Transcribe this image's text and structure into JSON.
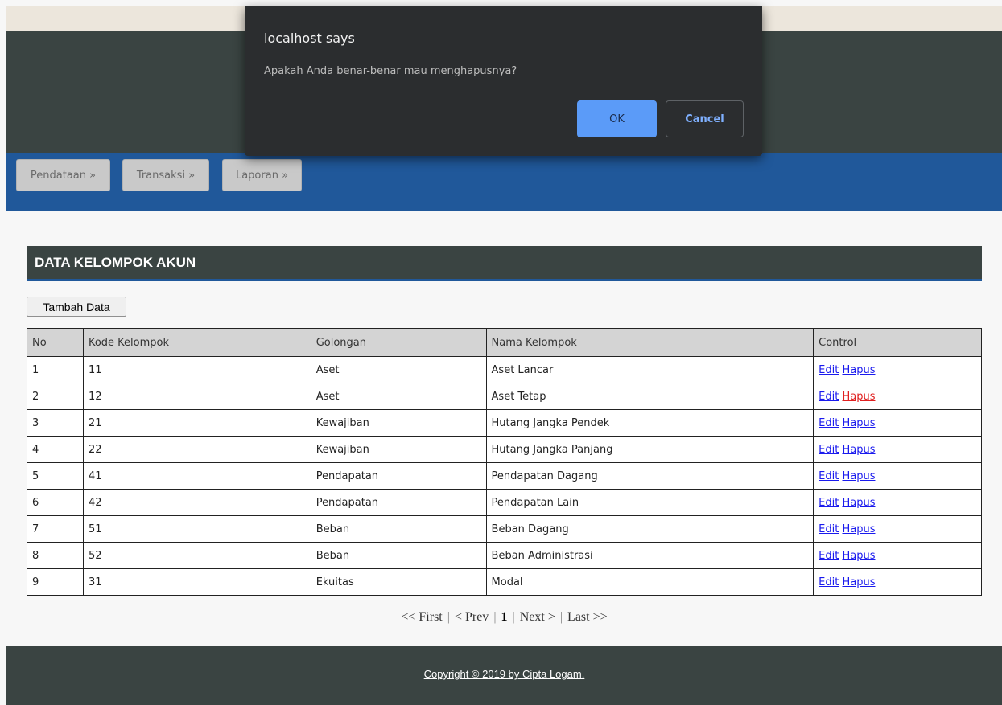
{
  "dialog": {
    "title": "localhost says",
    "message": "Apakah Anda benar-benar mau menghapusnya?",
    "ok_label": "OK",
    "cancel_label": "Cancel"
  },
  "nav": {
    "items": [
      {
        "label": "Pendataan »"
      },
      {
        "label": "Transaksi »"
      },
      {
        "label": "Laporan »"
      }
    ]
  },
  "section": {
    "title": "DATA KELOMPOK AKUN",
    "add_button": "Tambah Data"
  },
  "table": {
    "headers": [
      "No",
      "Kode Kelompok",
      "Golongan",
      "Nama Kelompok",
      "Control"
    ],
    "edit_label": "Edit",
    "hapus_label": "Hapus",
    "rows": [
      {
        "no": "1",
        "kode": "11",
        "golongan": "Aset",
        "nama": "Aset Lancar"
      },
      {
        "no": "2",
        "kode": "12",
        "golongan": "Aset",
        "nama": "Aset Tetap"
      },
      {
        "no": "3",
        "kode": "21",
        "golongan": "Kewajiban",
        "nama": "Hutang Jangka Pendek"
      },
      {
        "no": "4",
        "kode": "22",
        "golongan": "Kewajiban",
        "nama": "Hutang Jangka Panjang"
      },
      {
        "no": "5",
        "kode": "41",
        "golongan": "Pendapatan",
        "nama": "Pendapatan Dagang"
      },
      {
        "no": "6",
        "kode": "42",
        "golongan": "Pendapatan",
        "nama": "Pendapatan Lain"
      },
      {
        "no": "7",
        "kode": "51",
        "golongan": "Beban",
        "nama": "Beban Dagang"
      },
      {
        "no": "8",
        "kode": "52",
        "golongan": "Beban",
        "nama": "Beban Administrasi"
      },
      {
        "no": "9",
        "kode": "31",
        "golongan": "Ekuitas",
        "nama": "Modal"
      }
    ]
  },
  "pager": {
    "first": "<< First",
    "prev": "< Prev",
    "current": "1",
    "next": "Next >",
    "last": "Last >>"
  },
  "footer": {
    "copyright": "Copyright © 2019 by Cipta Logam."
  },
  "colors": {
    "banner": "#3a4442",
    "navbar": "#20589a",
    "link": "#1a1aee",
    "link_hover": "#e02020",
    "dialog_ok": "#5b9bf8"
  }
}
